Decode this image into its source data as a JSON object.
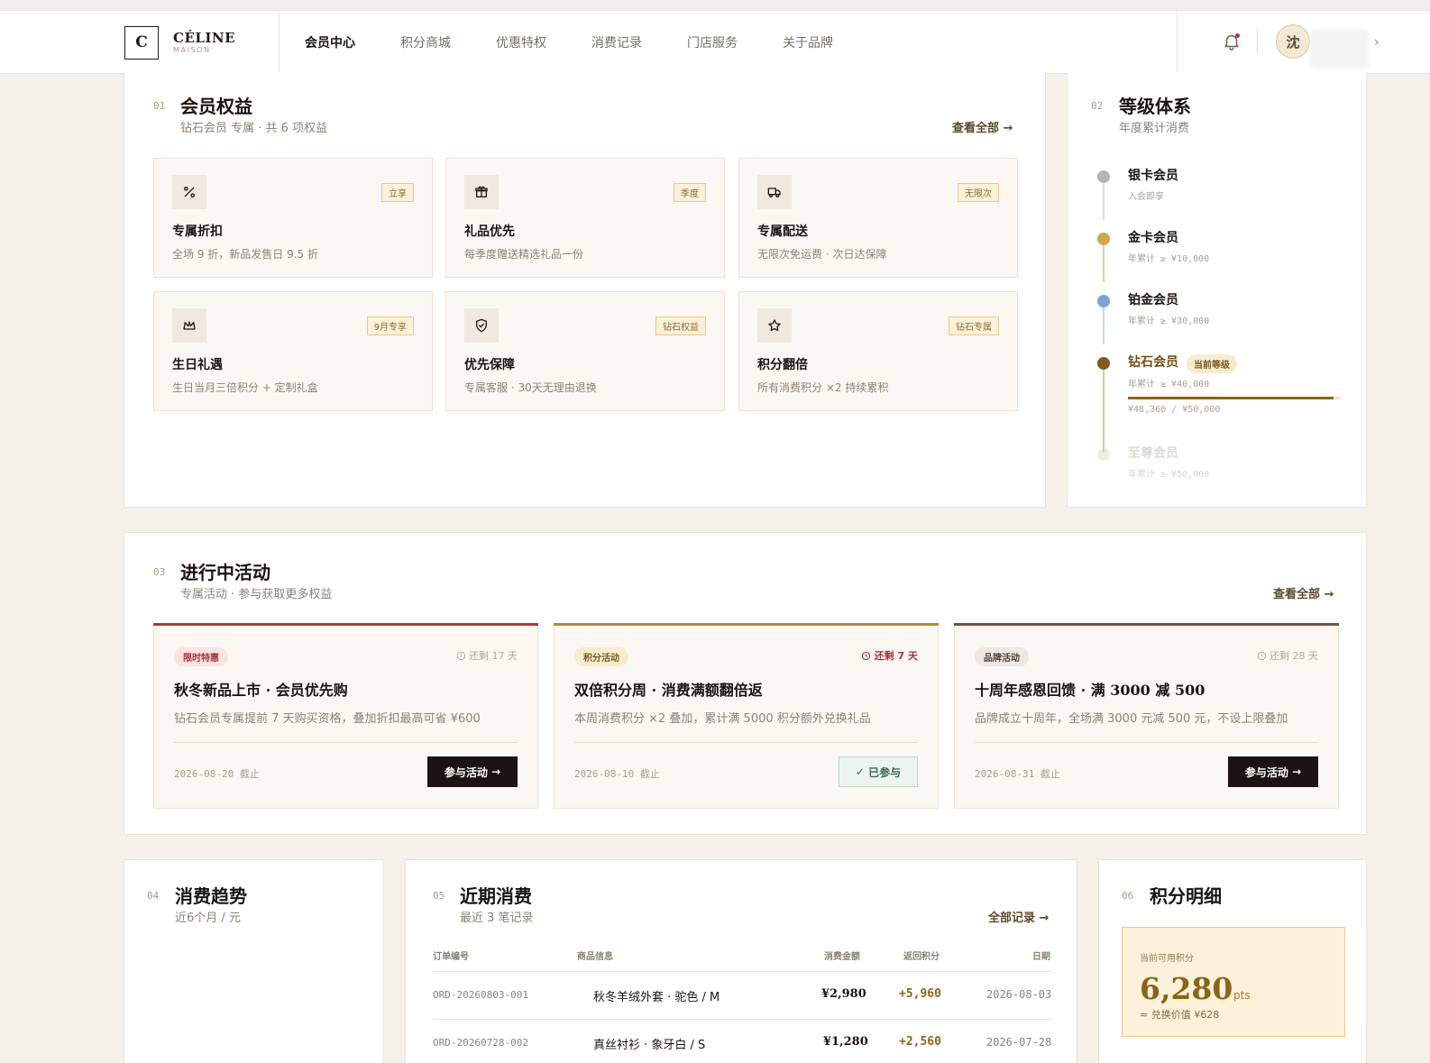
{
  "header": {
    "brand_mark": "C",
    "brand_name": "CÉLINE",
    "brand_sub": "MAISON",
    "nav": [
      {
        "label": "会员中心",
        "active": true
      },
      {
        "label": "积分商城",
        "active": false
      },
      {
        "label": "优惠特权",
        "active": false
      },
      {
        "label": "消费记录",
        "active": false
      },
      {
        "label": "门店服务",
        "active": false
      },
      {
        "label": "关于品牌",
        "active": false
      }
    ],
    "avatar_char": "沈"
  },
  "benefits": {
    "num": "01",
    "title": "会员权益",
    "subtitle": "钻石会员 专属 · 共 6 项权益",
    "view_all": "查看全部",
    "items": [
      {
        "icon": "percent-icon",
        "badge": "立享",
        "title": "专属折扣",
        "desc": "全场 9 折，新品发售日 9.5 折"
      },
      {
        "icon": "gift-icon",
        "badge": "季度",
        "title": "礼品优先",
        "desc": "每季度赠送精选礼品一份"
      },
      {
        "icon": "truck-icon",
        "badge": "无限次",
        "title": "专属配送",
        "desc": "无限次免运费 · 次日达保障"
      },
      {
        "icon": "crown-icon",
        "badge": "9月专享",
        "title": "生日礼遇",
        "desc": "生日当月三倍积分 + 定制礼盒"
      },
      {
        "icon": "shield-icon",
        "badge": "钻石权益",
        "title": "优先保障",
        "desc": "专属客服 · 30天无理由退换"
      },
      {
        "icon": "star-icon",
        "badge": "钻石专属",
        "title": "积分翻倍",
        "desc": "所有消费积分 ×2 持续累积"
      }
    ]
  },
  "tiers": {
    "num": "02",
    "title": "等级体系",
    "subtitle": "年度累计消费",
    "current_label": "当前等级",
    "progress_text": "¥48,360 / ¥50,000",
    "progress_fraction": 0.967,
    "items": [
      {
        "name": "银卡会员",
        "req": "入会即享",
        "color": "#b8b5b0",
        "state": "done"
      },
      {
        "name": "金卡会员",
        "req": "年累计 ≥ ¥10,000",
        "color": "#d4a64a",
        "state": "done"
      },
      {
        "name": "铂金会员",
        "req": "年累计 ≥ ¥30,000",
        "color": "#7ea3d1",
        "state": "done"
      },
      {
        "name": "钻石会员",
        "req": "年累计 ≥ ¥40,000",
        "color": "#7f5c1c",
        "state": "current"
      },
      {
        "name": "至尊会员",
        "req": "年累计 ≥ ¥50,000",
        "color": "#ece7df",
        "state": "locked"
      }
    ]
  },
  "activities": {
    "num": "03",
    "title": "进行中活动",
    "subtitle": "专属活动 · 参与获取更多权益",
    "view_all": "查看全部",
    "items": [
      {
        "tag": "限时特惠",
        "left": "还剩 17 天",
        "title": "秋冬新品上市 · 会员优先购",
        "desc": "钻石会员专属提前 7 天购买资格，叠加折扣最高可省 ¥600",
        "date": "2026-08-20 截止",
        "button": "参与活动",
        "joined": false,
        "accent": "#b2373a"
      },
      {
        "tag": "积分活动",
        "left": "还剩 7 天",
        "title": "双倍积分周 · 消费满额翻倍返",
        "desc": "本周消费积分 ×2 叠加，累计满 5000 积分额外兑换礼品",
        "date": "2026-08-10 截止",
        "button": "已参与",
        "joined": true,
        "accent": "#b88c2e"
      },
      {
        "tag": "品牌活动",
        "left": "还剩 28 天",
        "title": "十周年感恩回馈 · 满 3000 减 500",
        "desc": "品牌成立十周年，全场满 3000 元减 500 元，不设上限叠加",
        "date": "2026-08-31 截止",
        "button": "参与活动",
        "joined": false,
        "accent": "#6e5446"
      }
    ]
  },
  "trend": {
    "num": "04",
    "title": "消费趋势",
    "subtitle": "近6个月 / 元"
  },
  "recent": {
    "num": "05",
    "title": "近期消费",
    "subtitle": "最近 3 笔记录",
    "view_all": "全部记录",
    "columns": [
      "订单编号",
      "商品信息",
      "消费金额",
      "返回积分",
      "日期"
    ],
    "rows": [
      {
        "order": "ORD-20260803-001",
        "item": "秋冬羊绒外套 · 驼色 / M",
        "amount": "¥2,980",
        "points": "+5,960",
        "date": "2026-08-03"
      },
      {
        "order": "ORD-20260728-002",
        "item": "真丝衬衫 · 象牙白 / S",
        "amount": "¥1,280",
        "points": "+2,560",
        "date": "2026-07-28"
      }
    ]
  },
  "points": {
    "num": "06",
    "title": "积分明细",
    "label": "当前可用积分",
    "value": "6,280",
    "unit": "pts",
    "exchange": "≈ 兑换价值 ¥628"
  }
}
